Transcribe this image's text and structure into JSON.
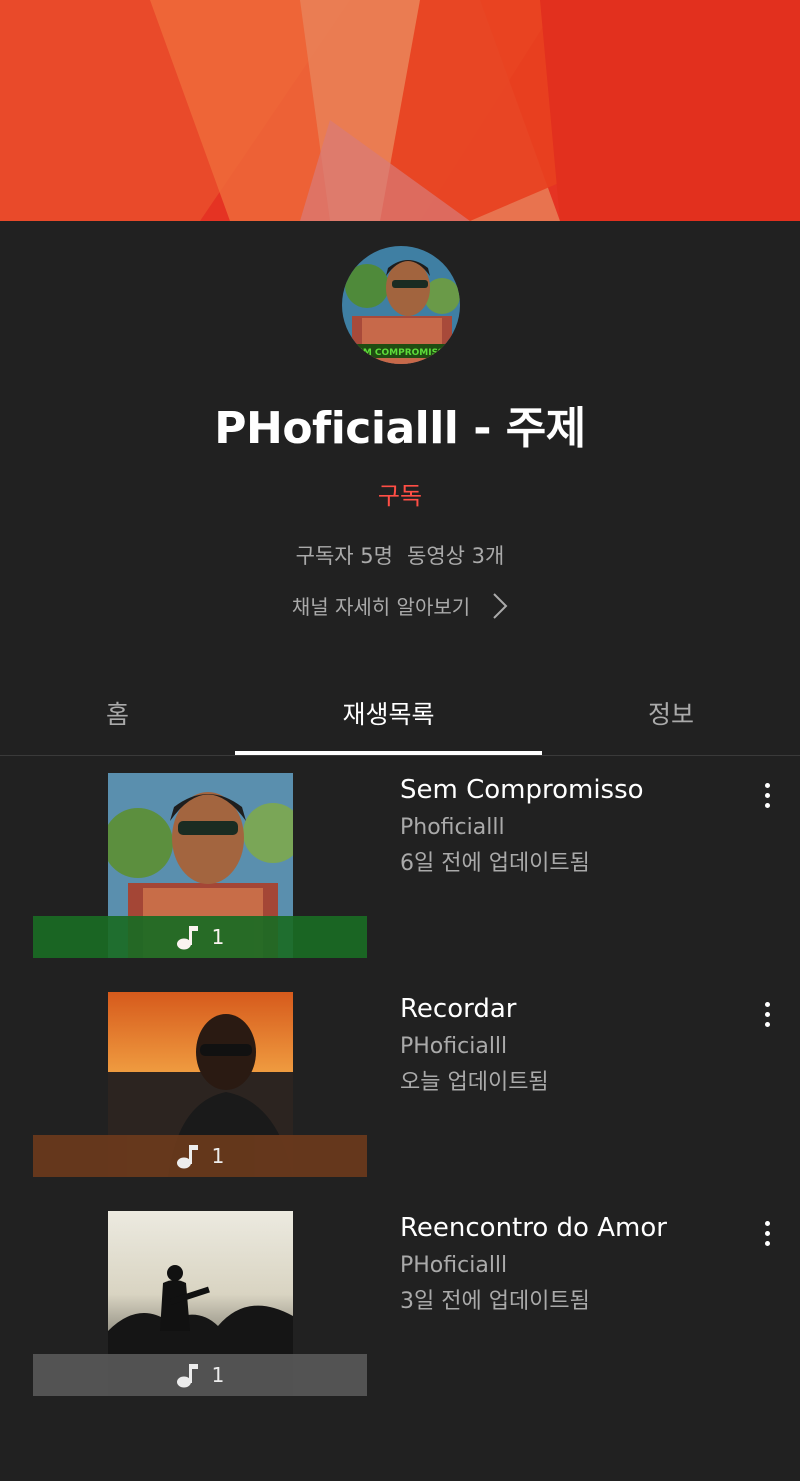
{
  "colors": {
    "background": "#212121",
    "banner": "#e53323",
    "subscribe": "#ff4e45",
    "secondary_text": "#aaaaaa",
    "tab_indicator": "#ffffff"
  },
  "channel": {
    "title": "PHoficialll - 주제",
    "subscribe_label": "구독",
    "subscribers": "구독자 5명",
    "videos": "동영상 3개",
    "learn_more": "채널 자세히 알아보기",
    "avatar_icon": "channel-avatar"
  },
  "tabs": {
    "home": "홈",
    "playlists": "재생목록",
    "about": "정보",
    "selected": "재생목록"
  },
  "playlists": [
    {
      "title": "Sem Compromisso",
      "owner": "Phoficialll",
      "updated": "6일 전에 업데이트됨",
      "count": "1",
      "bar_color": "#1a6b24",
      "icon": "music-note-icon"
    },
    {
      "title": "Recordar",
      "owner": "PHoficialll",
      "updated": "오늘 업데이트됨",
      "count": "1",
      "bar_color": "#6b3a1c",
      "icon": "music-note-icon"
    },
    {
      "title": "Reencontro do Amor",
      "owner": "PHoficialll",
      "updated": "3일 전에 업데이트됨",
      "count": "1",
      "bar_color": "#585858",
      "icon": "music-note-icon"
    }
  ]
}
